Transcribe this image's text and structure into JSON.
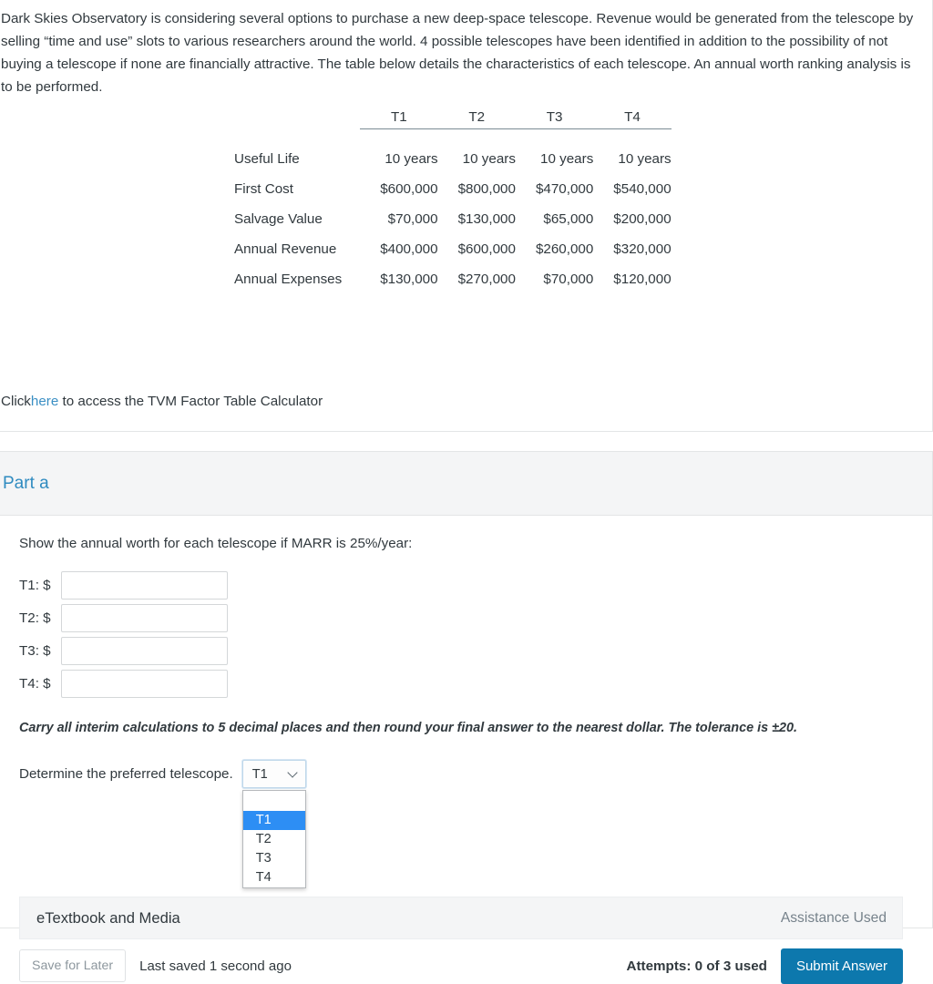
{
  "problem": {
    "paragraph": "Dark Skies Observatory is considering several options to purchase a new deep-space telescope. Revenue would be generated from the telescope by selling “time and use” slots to various researchers around the world. 4 possible telescopes have been identified in addition to the possibility of not buying a telescope if none are financially attractive. The table below details the characteristics of each telescope. An annual worth ranking analysis is to be performed.",
    "table": {
      "columns": [
        "T1",
        "T2",
        "T3",
        "T4"
      ],
      "rows": [
        {
          "label": "Useful Life",
          "values": [
            "10 years",
            "10 years",
            "10 years",
            "10 years"
          ]
        },
        {
          "label": "First Cost",
          "values": [
            "$600,000",
            "$800,000",
            "$470,000",
            "$540,000"
          ]
        },
        {
          "label": "Salvage Value",
          "values": [
            "$70,000",
            "$130,000",
            "$65,000",
            "$200,000"
          ]
        },
        {
          "label": "Annual Revenue",
          "values": [
            "$400,000",
            "$600,000",
            "$260,000",
            "$320,000"
          ]
        },
        {
          "label": "Annual Expenses",
          "values": [
            "$130,000",
            "$270,000",
            "$70,000",
            "$120,000"
          ]
        }
      ]
    },
    "tvm_prefix": "Click",
    "tvm_link": "here",
    "tvm_suffix": " to access the TVM Factor Table Calculator"
  },
  "part": {
    "title": "Part a",
    "prompt": "Show the annual worth for each telescope if MARR is 25%/year:",
    "answers": [
      {
        "label": "T1: $",
        "value": ""
      },
      {
        "label": "T2: $",
        "value": ""
      },
      {
        "label": "T3: $",
        "value": ""
      },
      {
        "label": "T4: $",
        "value": ""
      }
    ],
    "tolerance_note": "Carry all interim calculations to 5 decimal places and then round your final answer to the nearest dollar. The tolerance is ±20.",
    "determine_label": "Determine the preferred telescope.",
    "select": {
      "value": "T1",
      "options": [
        "",
        "T1",
        "T2",
        "T3",
        "T4"
      ],
      "selected_index": 1
    }
  },
  "etextbook": {
    "label": "eTextbook and Media",
    "assistance": "Assistance Used"
  },
  "footer": {
    "save_label": "Save for Later",
    "last_saved": "Last saved 1 second ago",
    "attempts": "Attempts: 0 of 3 used",
    "submit_label": "Submit Answer"
  },
  "colors": {
    "link": "#3a8fc4",
    "part_title": "#2f8bc0",
    "submit": "#0d78ad",
    "option_highlight": "#2d8ef4",
    "text": "#31393e"
  }
}
